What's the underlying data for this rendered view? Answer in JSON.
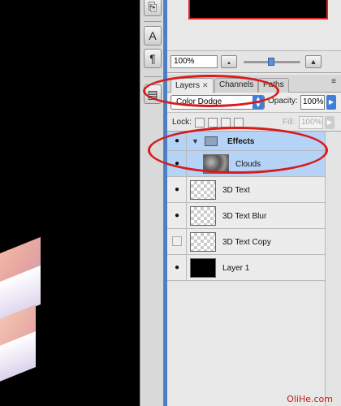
{
  "tools": {
    "type_tool_glyph": "A",
    "paragraph_glyph": "¶"
  },
  "navigator": {
    "zoom_value": "100%",
    "zoom_out_glyph": "▲",
    "zoom_in_glyph": "▲"
  },
  "layers_panel": {
    "tabs": [
      {
        "label": "Layers",
        "close": "✕"
      },
      {
        "label": "Channels"
      },
      {
        "label": "Paths"
      }
    ],
    "blend_mode": "Color Dodge",
    "opacity_label": "Opacity:",
    "opacity_value": "100%",
    "lock_label": "Lock:",
    "fill_label": "Fill:",
    "fill_value": "100%",
    "layers": [
      {
        "name": "Effects",
        "type": "group",
        "visible": true,
        "expanded": true
      },
      {
        "name": "Clouds",
        "type": "layer",
        "visible": true,
        "thumb": "clouds"
      },
      {
        "name": "3D Text",
        "type": "layer",
        "visible": true,
        "thumb": "checker"
      },
      {
        "name": "3D Text Blur",
        "type": "layer",
        "visible": true,
        "thumb": "checker"
      },
      {
        "name": "3D Text Copy",
        "type": "layer",
        "visible": false,
        "thumb": "checker"
      },
      {
        "name": "Layer 1",
        "type": "layer",
        "visible": true,
        "thumb": "black"
      }
    ]
  },
  "watermark": {
    "text": "OliHe.com"
  },
  "colors": {
    "panel_frame": "#4b7fc6",
    "selection": "#b5d3f6",
    "annotation_oval": "#d81c1c"
  }
}
